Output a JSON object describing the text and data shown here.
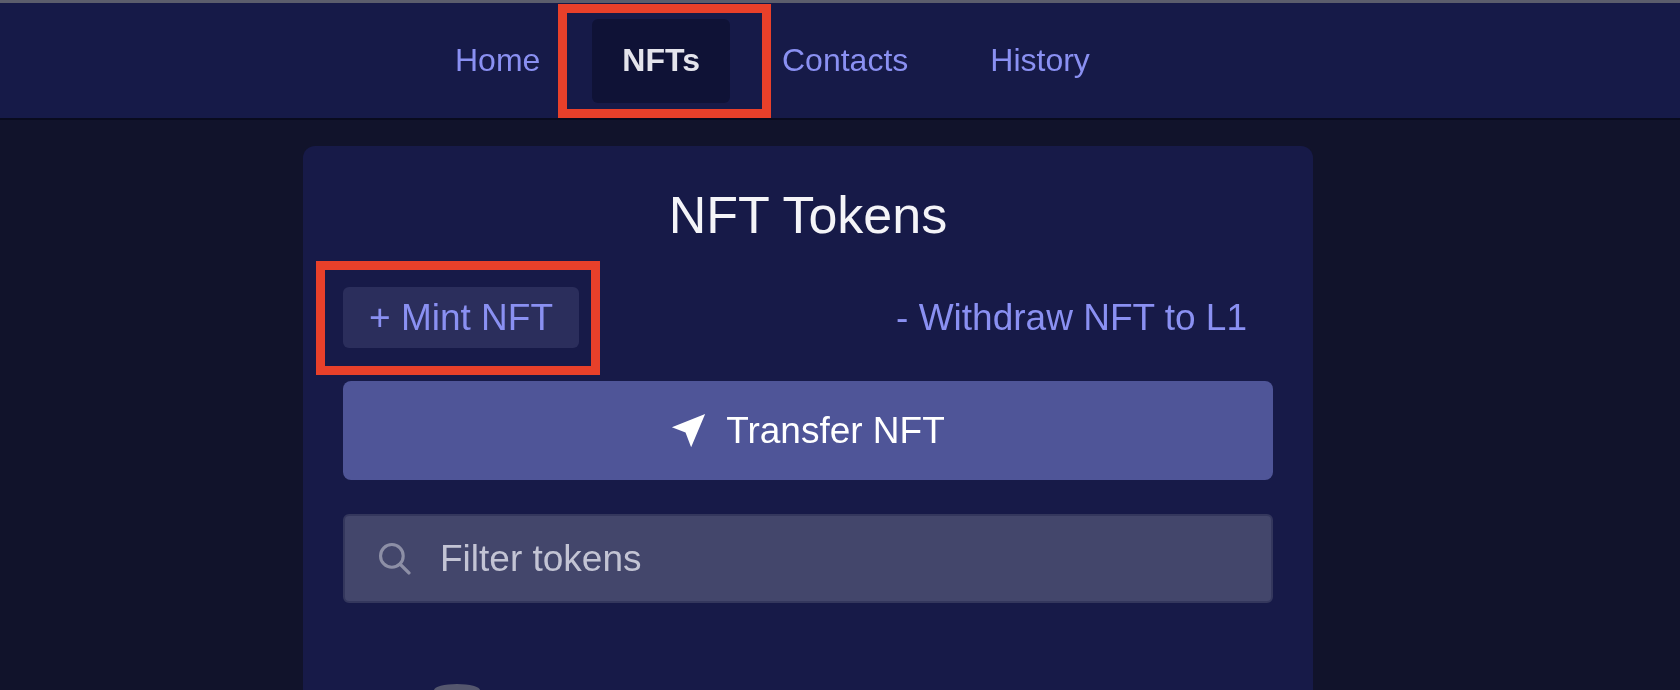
{
  "nav": {
    "items": [
      {
        "label": "Home",
        "selected": false,
        "highlighted": false
      },
      {
        "label": "NFTs",
        "selected": true,
        "highlighted": true
      },
      {
        "label": "Contacts",
        "selected": false,
        "highlighted": false
      },
      {
        "label": "History",
        "selected": false,
        "highlighted": false
      }
    ]
  },
  "card": {
    "title": "NFT Tokens",
    "actions": [
      {
        "label": "+ Mint NFT",
        "kind": "filled",
        "highlighted": true
      },
      {
        "label": "- Withdraw NFT to L1",
        "kind": "plain",
        "highlighted": false
      }
    ],
    "primary_button": {
      "label": "Transfer NFT"
    },
    "filter": {
      "placeholder": "Filter tokens"
    }
  }
}
